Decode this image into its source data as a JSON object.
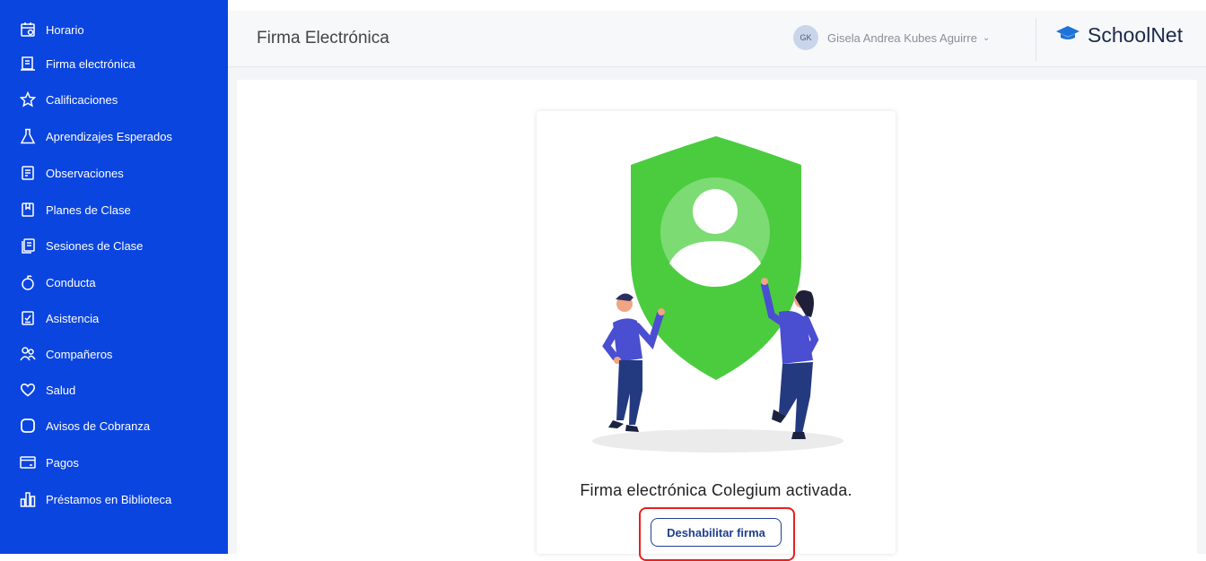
{
  "sidebar": {
    "items": [
      {
        "label": "Horario",
        "icon": "calendar-icon"
      },
      {
        "label": "Firma electrónica",
        "icon": "document-sign-icon"
      },
      {
        "label": "Calificaciones",
        "icon": "star-icon"
      },
      {
        "label": "Aprendizajes Esperados",
        "icon": "flask-icon"
      },
      {
        "label": "Observaciones",
        "icon": "notes-icon"
      },
      {
        "label": "Planes de Clase",
        "icon": "book-icon"
      },
      {
        "label": "Sesiones de Clase",
        "icon": "stack-icon"
      },
      {
        "label": "Conducta",
        "icon": "apple-icon"
      },
      {
        "label": "Asistencia",
        "icon": "checklist-icon"
      },
      {
        "label": "Compañeros",
        "icon": "users-icon"
      },
      {
        "label": "Salud",
        "icon": "heart-icon"
      },
      {
        "label": "Avisos de Cobranza",
        "icon": "square-icon"
      },
      {
        "label": "Pagos",
        "icon": "credit-card-icon"
      },
      {
        "label": "Préstamos en Biblioteca",
        "icon": "bars-icon"
      }
    ]
  },
  "header": {
    "title": "Firma Electrónica",
    "user_initials": "GK",
    "user_name": "Gisela Andrea Kubes Aguirre",
    "chevron": "⌄",
    "brand": "SchoolNet"
  },
  "main": {
    "status_text": "Firma electrónica Colegium activada.",
    "disable_button": "Deshabilitar firma"
  },
  "colors": {
    "sidebar": "#0b45e0",
    "shield": "#4bcc3f",
    "highlight": "#e8201c"
  }
}
